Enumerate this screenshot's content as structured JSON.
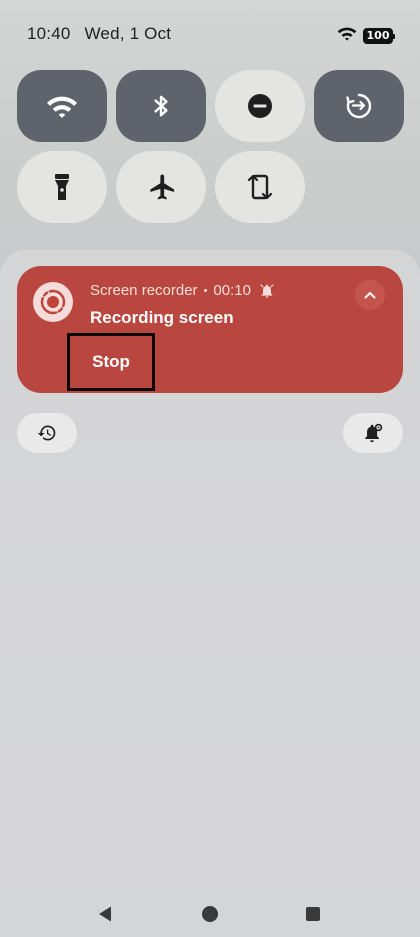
{
  "status_bar": {
    "time": "10:40",
    "date": "Wed, 1 Oct",
    "battery": "100"
  },
  "quick_settings": {
    "tiles": [
      {
        "icon": "wifi-icon",
        "state": "on"
      },
      {
        "icon": "bluetooth-icon",
        "state": "on"
      },
      {
        "icon": "do-not-disturb-icon",
        "state": "off"
      },
      {
        "icon": "data-saver-icon",
        "state": "on"
      },
      {
        "icon": "flashlight-icon",
        "state": "off"
      },
      {
        "icon": "airplane-mode-icon",
        "state": "off"
      },
      {
        "icon": "auto-rotate-icon",
        "state": "off"
      }
    ]
  },
  "notification": {
    "app_name": "Screen recorder",
    "separator": "•",
    "elapsed": "00:10",
    "title": "Recording screen",
    "action": "Stop",
    "accent_color": "#b9473f"
  },
  "footer": {
    "history_icon": "history-icon",
    "notification_settings_icon": "notification-settings-icon"
  },
  "navigation": {
    "items": [
      "back-icon",
      "home-icon",
      "recents-icon"
    ]
  }
}
